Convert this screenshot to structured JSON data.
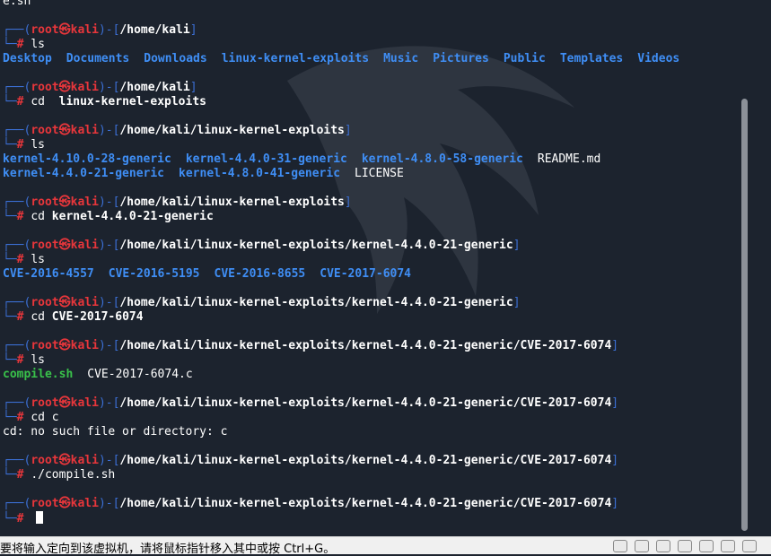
{
  "terminal": {
    "first_line": "e.sh",
    "prompt_user": "root㉿kali",
    "sessions": [
      {
        "path": "/home/kali",
        "command": "ls",
        "output": [
          [
            {
              "t": "Desktop",
              "c": "dir"
            },
            {
              "t": "Documents",
              "c": "dir"
            },
            {
              "t": "Downloads",
              "c": "dir"
            },
            {
              "t": "linux-kernel-exploits",
              "c": "dir"
            },
            {
              "t": "Music",
              "c": "dir"
            },
            {
              "t": "Pictures",
              "c": "dir"
            },
            {
              "t": "Public",
              "c": "dir"
            },
            {
              "t": "Templates",
              "c": "dir"
            },
            {
              "t": "Videos",
              "c": "dir"
            }
          ]
        ]
      },
      {
        "path": "/home/kali",
        "command": "cd  linux-kernel-exploits",
        "cmd_bold": true,
        "output": []
      },
      {
        "path": "/home/kali/linux-kernel-exploits",
        "command": "ls",
        "output": [
          [
            {
              "t": "kernel-4.10.0-28-generic",
              "c": "dir"
            },
            {
              "t": "kernel-4.4.0-31-generic",
              "c": "dir"
            },
            {
              "t": "kernel-4.8.0-58-generic",
              "c": "dir"
            },
            {
              "t": "README.md",
              "c": "file"
            }
          ],
          [
            {
              "t": "kernel-4.4.0-21-generic",
              "c": "dir"
            },
            {
              "t": "kernel-4.8.0-41-generic",
              "c": "dir"
            },
            {
              "t": "LICENSE",
              "c": "file"
            }
          ]
        ]
      },
      {
        "path": "/home/kali/linux-kernel-exploits",
        "command": "kernel-4.4.0-21-generic",
        "cd": true,
        "output": []
      },
      {
        "path": "/home/kali/linux-kernel-exploits/kernel-4.4.0-21-generic",
        "command": "ls",
        "output": [
          [
            {
              "t": "CVE-2016-4557",
              "c": "dir"
            },
            {
              "t": "CVE-2016-5195",
              "c": "dir"
            },
            {
              "t": "CVE-2016-8655",
              "c": "dir"
            },
            {
              "t": "CVE-2017-6074",
              "c": "dir"
            }
          ]
        ]
      },
      {
        "path": "/home/kali/linux-kernel-exploits/kernel-4.4.0-21-generic",
        "command": "CVE-2017-6074",
        "cd": true,
        "output": []
      },
      {
        "path": "/home/kali/linux-kernel-exploits/kernel-4.4.0-21-generic/CVE-2017-6074",
        "command": "ls",
        "output": [
          [
            {
              "t": "compile.sh",
              "c": "exec"
            },
            {
              "t": "CVE-2017-6074.c",
              "c": "file"
            }
          ]
        ]
      },
      {
        "path": "/home/kali/linux-kernel-exploits/kernel-4.4.0-21-generic/CVE-2017-6074",
        "command": "cd c",
        "output_text": [
          "cd: no such file or directory: c"
        ]
      },
      {
        "path": "/home/kali/linux-kernel-exploits/kernel-4.4.0-21-generic/CVE-2017-6074",
        "command": "./compile.sh",
        "output": []
      },
      {
        "path": "/home/kali/linux-kernel-exploits/kernel-4.4.0-21-generic/CVE-2017-6074",
        "command": "",
        "cursor": true
      }
    ]
  },
  "statusbar": {
    "message": "要将输入定向到该虚拟机，请将鼠标指针移入其中或按 Ctrl+G。"
  },
  "colors": {
    "background": "#1c232e",
    "prompt_line": "#3b6fd4",
    "user": "#e8363b",
    "dir": "#3f8ef5",
    "exec": "#39c14a"
  }
}
